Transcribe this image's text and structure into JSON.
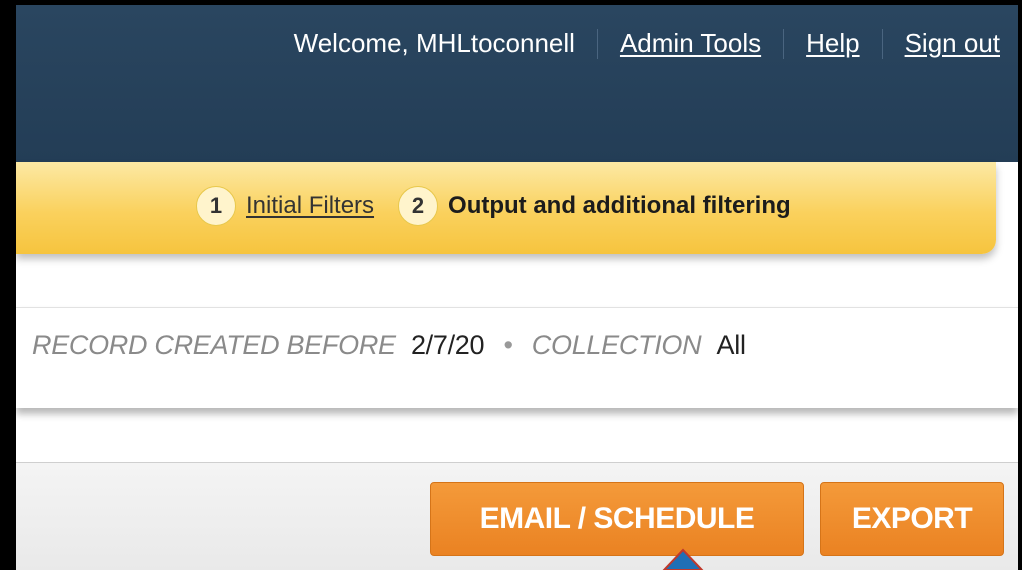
{
  "header": {
    "welcome_text": "Welcome, MHLtoconnell",
    "admin_tools_label": "Admin Tools",
    "help_label": "Help",
    "sign_out_label": "Sign out"
  },
  "steps": {
    "step1_number": "1",
    "step1_label": "Initial Filters",
    "step2_number": "2",
    "step2_label": "Output and additional filtering"
  },
  "filters": {
    "record_created_label": "RECORD CREATED BEFORE",
    "record_created_value": "2/7/20",
    "separator": "•",
    "collection_label": "COLLECTION",
    "collection_value": "All"
  },
  "actions": {
    "email_schedule_label": "EMAIL / SCHEDULE",
    "export_label": "EXPORT"
  },
  "colors": {
    "header_bg": "#233d56",
    "steps_bar_bg": "#fad15d",
    "button_orange": "#ee8a2a",
    "pointer": "#1f6fb5"
  },
  "icons": {
    "pointer": "up-arrow-pointer-icon"
  }
}
